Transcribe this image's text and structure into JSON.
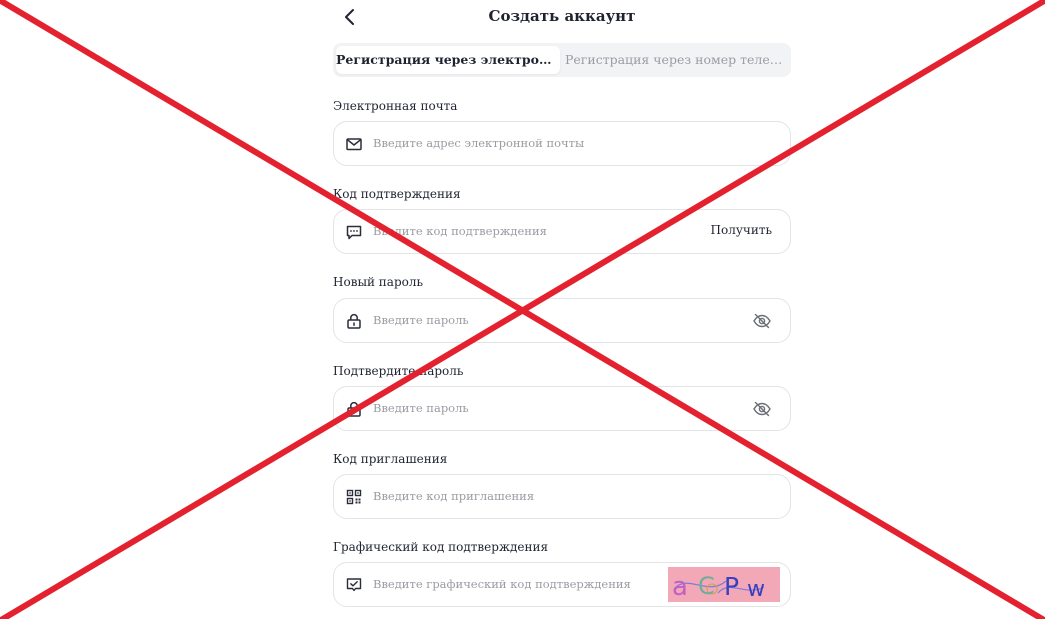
{
  "header": {
    "title": "Создать аккаунт",
    "back_icon": "chevron-left-icon"
  },
  "tabs": [
    {
      "label": "Регистрация через электронну…",
      "active": true
    },
    {
      "label": "Регистрация через номер телефона",
      "active": false
    }
  ],
  "fields": {
    "email": {
      "label": "Электронная почта",
      "placeholder": "Введите адрес электронной почты",
      "icon": "mail-icon"
    },
    "code": {
      "label": "Код подтверждения",
      "placeholder": "Введите код подтверждения",
      "icon": "message-icon",
      "action_label": "Получить"
    },
    "password": {
      "label": "Новый пароль",
      "placeholder": "Введите пароль",
      "icon": "lock-icon",
      "toggle_icon": "eye-off-icon"
    },
    "confirm_password": {
      "label": "Подтвердите пароль",
      "placeholder": "Введите пароль",
      "icon": "lock-icon",
      "toggle_icon": "eye-off-icon"
    },
    "invite": {
      "label": "Код приглашения",
      "placeholder": "Введите код приглашения",
      "icon": "qr-code-icon"
    },
    "captcha": {
      "label": "Графический код подтверждения",
      "placeholder": "Введите графический код подтверждения",
      "icon": "checkbox-icon",
      "image_text": "aCPw"
    }
  },
  "colors": {
    "overlay_cross": "#e3212f",
    "captcha_bg": "#f3a8b7",
    "tab_bg": "#f2f3f5",
    "placeholder": "#9a9ca3"
  }
}
